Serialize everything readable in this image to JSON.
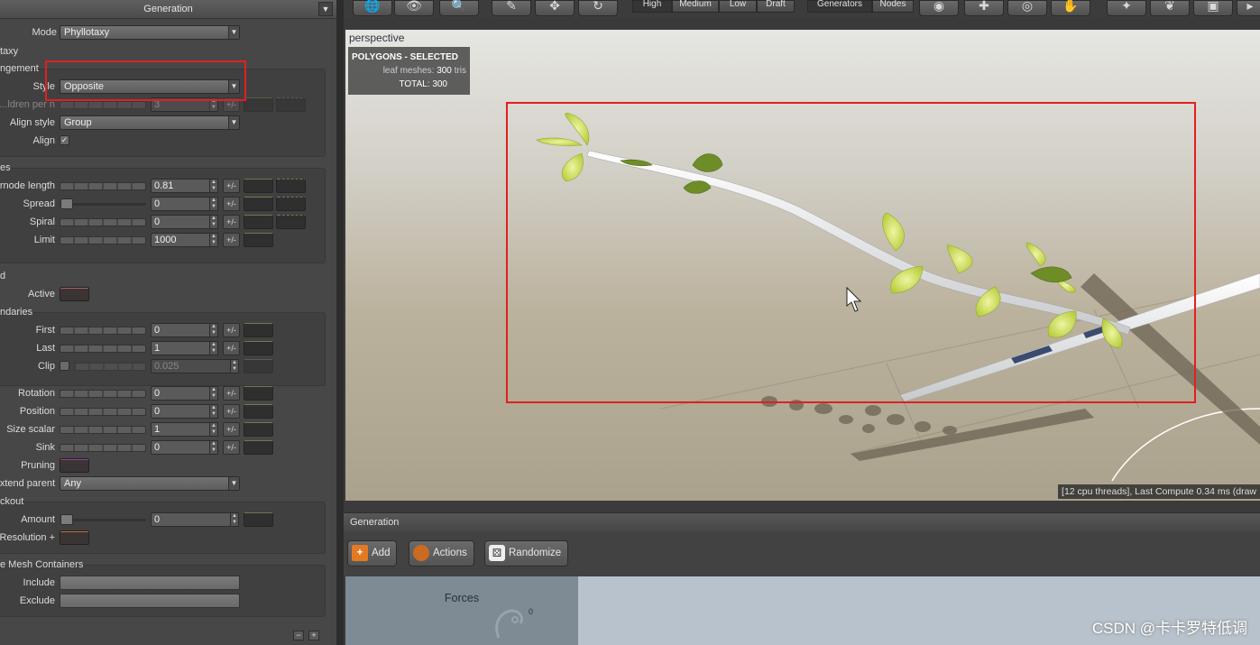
{
  "panel": {
    "header": "Generation",
    "mode_label": "Mode",
    "mode_value": "Phyllotaxy",
    "phyllotaxy_group": "taxy",
    "arrangement_group": "ngement",
    "style_label": "Style",
    "style_value": "Opposite",
    "children_label": "ldren per n...",
    "children_value": "3",
    "align_style_label": "Align style",
    "align_style_value": "Group",
    "align_label": "Align",
    "align_checked": "✓",
    "nodes_group": "es",
    "internode_label": "rnode length",
    "internode_value": "0.81",
    "spread_label": "Spread",
    "spread_value": "0",
    "spiral_label": "Spiral",
    "spiral_value": "0",
    "limit_label": "Limit",
    "limit_value": "1000",
    "d_group": "d",
    "active_label": "Active",
    "boundaries_group": "ndaries",
    "first_label": "First",
    "first_value": "0",
    "last_label": "Last",
    "last_value": "1",
    "clip_label": "Clip",
    "clip_value": "0.025",
    "rotation_label": "Rotation",
    "rotation_value": "0",
    "position_label": "Position",
    "position_value": "0",
    "size_scalar_label": "Size scalar",
    "size_scalar_value": "1",
    "sink_label": "Sink",
    "sink_value": "0",
    "pruning_label": "Pruning",
    "extend_parent_label": "xtend parent",
    "extend_parent_value": "Any",
    "knockout_group": "ckout",
    "amount_label": "Amount",
    "amount_value": "0",
    "resolution_label": "+ Resolution",
    "mesh_containers_group": "e Mesh Containers",
    "include_label": "Include",
    "exclude_label": "Exclude",
    "plusminus": "+/-"
  },
  "toolbar": {
    "lod": [
      "High",
      "Medium",
      "Low",
      "Draft"
    ],
    "modes": [
      "Generators",
      "Nodes"
    ]
  },
  "viewport": {
    "title": "perspective",
    "poly_header": "POLYGONS - SELECTED",
    "leaf_meshes_label": "leaf meshes:",
    "leaf_meshes_value": "300",
    "leaf_meshes_unit": "tris",
    "total_label": "TOTAL:",
    "total_value": "300",
    "status": "[12 cpu threads], Last Compute 0.34 ms (draw"
  },
  "bottom": {
    "header": "Generation",
    "add": "Add",
    "actions": "Actions",
    "randomize": "Randomize",
    "forces": "Forces",
    "forces_count": "0"
  },
  "watermark": "CSDN @卡卡罗特低调"
}
